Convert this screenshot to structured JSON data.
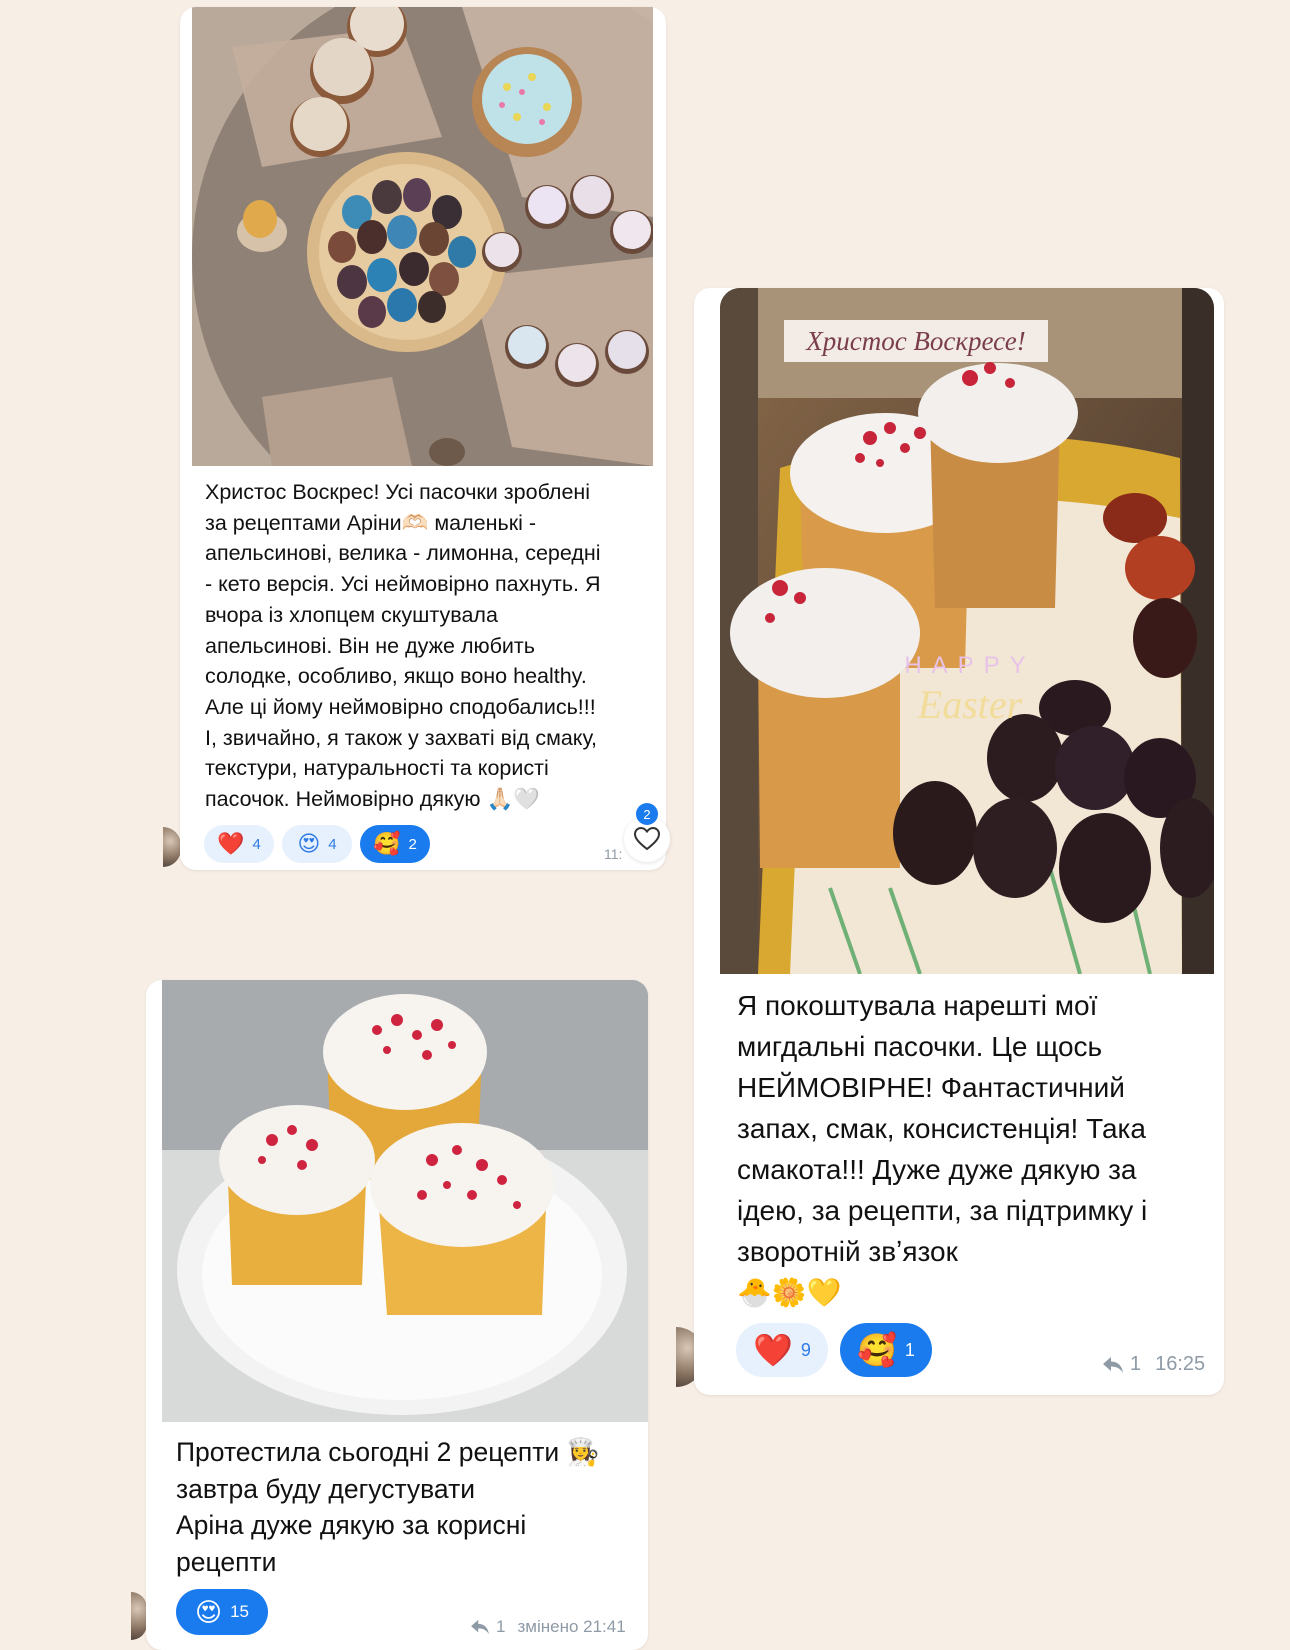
{
  "messages": [
    {
      "text": "Христос Воскрес! Усі пасочки зроблені\nза рецептами Аріни🫶🏻 маленькі -\nапельсинові, велика - лимонна, середні\n- кето версія. Усі неймовірно пахнуть. Я\nвчора із хлопцем скуштувала\nапельсинові. Він не дуже любить\nсолодке, особливо, якщо воно healthy.\nАле ці йому неймовірно сподобались!!!\nІ, звичайно, я також у захваті від смаку,\nтекстури, натуральності та користі\nпасочок. Неймовірно дякую 🙏🏻🤍",
      "reactions": [
        {
          "emoji": "❤️",
          "count": "4",
          "active": false
        },
        {
          "emoji": "😍",
          "count": "4",
          "active": false
        },
        {
          "emoji": "🥰",
          "count": "2",
          "active": true
        }
      ],
      "time": "11:",
      "like_badge": "2"
    },
    {
      "photo_caption": "Христос Воскресе!",
      "sticker_top": "HAPPY",
      "sticker_bottom": "Easter",
      "text": "Я покоштувала нарешті мої\nмигдальні пасочки. Це щось\nНЕЙМОВІРНЕ! Фантастичний\nзапах, смак, консистенція! Така\nсмакота!!! Дуже дуже дякую за\nідею, за рецепти, за підтримку і\nзворотній звʼязок\n🐣🌼💛",
      "reactions": [
        {
          "emoji": "❤️",
          "count": "9",
          "active": false
        },
        {
          "emoji": "🥰",
          "count": "1",
          "active": true
        }
      ],
      "replies": "1",
      "time": "16:25"
    },
    {
      "text": "Протестила сьогодні 2 рецепти 👩‍🍳\nзавтра буду дегустувати\nАріна дуже дякую за корисні\nрецепти",
      "reactions": [
        {
          "emoji": "😍",
          "count": "15",
          "active": true
        }
      ],
      "replies": "1",
      "time": "змінено 21:41"
    }
  ],
  "colors": {
    "background": "#f7eee6",
    "reaction_bg": "#e7f1fd",
    "reaction_active": "#1a7bef",
    "meta_text": "#8e9aa6"
  }
}
